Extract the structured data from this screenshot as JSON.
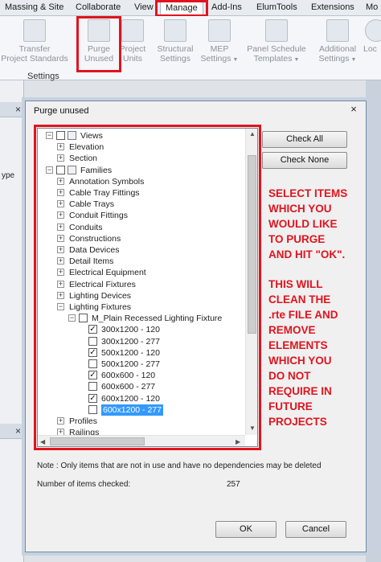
{
  "ribbon": {
    "tabs": [
      "Massing & Site",
      "Collaborate",
      "View",
      "Manage",
      "Add-Ins",
      "ElumTools",
      "Extensions",
      "Mo"
    ],
    "active_tab": "Manage",
    "buttons": [
      {
        "line1": "Transfer",
        "line2": "Project Standards"
      },
      {
        "line1": "Purge",
        "line2": "Unused"
      },
      {
        "line1": "Project",
        "line2": "Units"
      },
      {
        "line1": "Structural",
        "line2": "Settings"
      },
      {
        "line1": "MEP",
        "line2": "Settings"
      },
      {
        "line1": "Panel Schedule",
        "line2": "Templates"
      },
      {
        "line1": "Additional",
        "line2": "Settings"
      },
      {
        "line1": "Loc",
        "line2": ""
      }
    ],
    "panel_label": "Settings"
  },
  "background": {
    "left_fragments": [
      "ype"
    ]
  },
  "dialog": {
    "title": "Purge unused",
    "close_glyph": "×",
    "tree": [
      {
        "label": "Views",
        "level": 0,
        "expander": "−",
        "checkbox": "",
        "icon": true
      },
      {
        "label": "Elevation",
        "level": 1,
        "expander": "+",
        "checkbox": null
      },
      {
        "label": "Section",
        "level": 1,
        "expander": "+",
        "checkbox": null
      },
      {
        "label": "Families",
        "level": 0,
        "expander": "−",
        "checkbox": "",
        "icon": true
      },
      {
        "label": "Annotation Symbols",
        "level": 1,
        "expander": "+",
        "checkbox": null
      },
      {
        "label": "Cable Tray Fittings",
        "level": 1,
        "expander": "+",
        "checkbox": null
      },
      {
        "label": "Cable Trays",
        "level": 1,
        "expander": "+",
        "checkbox": null
      },
      {
        "label": "Conduit Fittings",
        "level": 1,
        "expander": "+",
        "checkbox": null
      },
      {
        "label": "Conduits",
        "level": 1,
        "expander": "+",
        "checkbox": null
      },
      {
        "label": "Constructions",
        "level": 1,
        "expander": "+",
        "checkbox": null
      },
      {
        "label": "Data Devices",
        "level": 1,
        "expander": "+",
        "checkbox": null
      },
      {
        "label": "Detail Items",
        "level": 1,
        "expander": "+",
        "checkbox": null
      },
      {
        "label": "Electrical Equipment",
        "level": 1,
        "expander": "+",
        "checkbox": null
      },
      {
        "label": "Electrical Fixtures",
        "level": 1,
        "expander": "+",
        "checkbox": null
      },
      {
        "label": "Lighting Devices",
        "level": 1,
        "expander": "+",
        "checkbox": null
      },
      {
        "label": "Lighting Fixtures",
        "level": 1,
        "expander": "−",
        "checkbox": null
      },
      {
        "label": "M_Plain Recessed Lighting Fixture",
        "level": 2,
        "expander": "−",
        "checkbox": ""
      },
      {
        "label": "300x1200 - 120",
        "level": 3,
        "expander": null,
        "checkbox": "✓"
      },
      {
        "label": "300x1200 - 277",
        "level": 3,
        "expander": null,
        "checkbox": ""
      },
      {
        "label": "500x1200 - 120",
        "level": 3,
        "expander": null,
        "checkbox": "✓"
      },
      {
        "label": "500x1200 - 277",
        "level": 3,
        "expander": null,
        "checkbox": ""
      },
      {
        "label": "600x600 - 120",
        "level": 3,
        "expander": null,
        "checkbox": "✓"
      },
      {
        "label": "600x600 - 277",
        "level": 3,
        "expander": null,
        "checkbox": ""
      },
      {
        "label": "600x1200 - 120",
        "level": 3,
        "expander": null,
        "checkbox": "✓"
      },
      {
        "label": "600x1200 - 277",
        "level": 3,
        "expander": null,
        "checkbox": "",
        "selected": true
      },
      {
        "label": "Profiles",
        "level": 1,
        "expander": "+",
        "checkbox": null
      },
      {
        "label": "Railings",
        "level": 1,
        "expander": "+",
        "checkbox": null
      }
    ],
    "check_all_label": "Check All",
    "check_none_label": "Check None",
    "note": "Note : Only items that are not in use and have no dependencies may be deleted",
    "count_label": "Number of items checked:",
    "count_value": "257",
    "ok_label": "OK",
    "cancel_label": "Cancel"
  },
  "annotation": {
    "color": "#e0141e",
    "paragraph1": [
      "SELECT ITEMS",
      "WHICH YOU",
      "WOULD LIKE",
      "TO PURGE",
      "AND HIT \"OK\"."
    ],
    "paragraph2": [
      "THIS WILL",
      "CLEAN THE",
      ".rte FILE AND",
      "REMOVE",
      "ELEMENTS",
      "WHICH YOU",
      "DO NOT",
      "REQUIRE IN",
      "FUTURE",
      "PROJECTS"
    ]
  }
}
